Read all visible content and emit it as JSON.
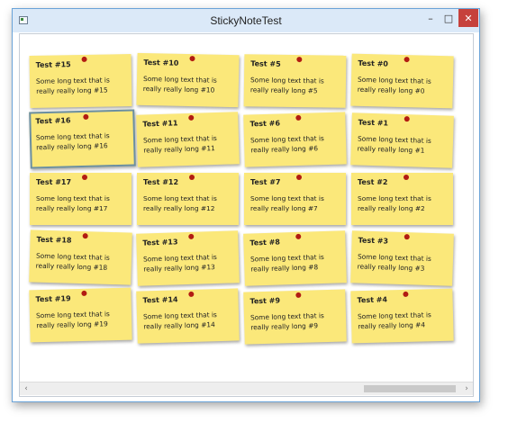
{
  "window": {
    "title": "StickyNoteTest",
    "minimize_label": "–",
    "maximize_label": "□",
    "close_label": "✕"
  },
  "notes": [
    {
      "title": "Test #15",
      "body": "Some long text that is really really long #15"
    },
    {
      "title": "Test #10",
      "body": "Some long text that is really really long #10"
    },
    {
      "title": "Test #5",
      "body": "Some long text that is really really long #5"
    },
    {
      "title": "Test #0",
      "body": "Some long text that is really really long #0"
    },
    {
      "title": "Test #16",
      "body": "Some long text that is really really long #16"
    },
    {
      "title": "Test #11",
      "body": "Some long text that is really really long #11"
    },
    {
      "title": "Test #6",
      "body": "Some long text that is really really long #6"
    },
    {
      "title": "Test #1",
      "body": "Some long text that is really really long #1"
    },
    {
      "title": "Test #17",
      "body": "Some long text that is really really long #17"
    },
    {
      "title": "Test #12",
      "body": "Some long text that is really really long #12"
    },
    {
      "title": "Test #7",
      "body": "Some long text that is really really long #7"
    },
    {
      "title": "Test #2",
      "body": "Some long text that is really really long #2"
    },
    {
      "title": "Test #18",
      "body": "Some long text that is really really long #18"
    },
    {
      "title": "Test #13",
      "body": "Some long text that is really really long #13"
    },
    {
      "title": "Test #8",
      "body": "Some long text that is really really long #8"
    },
    {
      "title": "Test #3",
      "body": "Some long text that is really really long #3"
    },
    {
      "title": "Test #19",
      "body": "Some long text that is really really long #19"
    },
    {
      "title": "Test #14",
      "body": "Some long text that is really really long #14"
    },
    {
      "title": "Test #9",
      "body": "Some long text that is really really long #9"
    },
    {
      "title": "Test #4",
      "body": "Some long text that is really really long #4"
    }
  ],
  "colors": {
    "note_background": "#fbe87a",
    "pin": "#b21c12",
    "selected_border": "#6b8fa3",
    "close_button": "#c6413c"
  },
  "icons": {
    "left_arrow": "‹",
    "right_arrow": "›"
  },
  "horizontal_scroll_position": 0.75
}
